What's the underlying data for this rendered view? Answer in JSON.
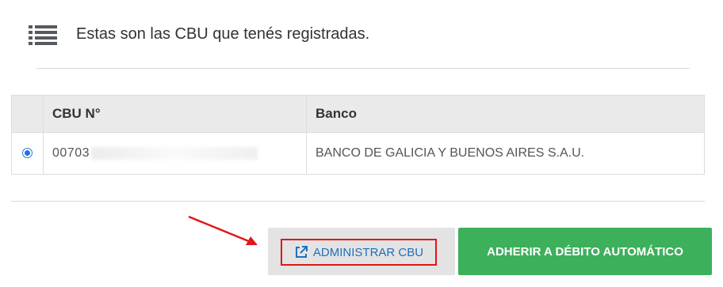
{
  "header": {
    "icon": "list-icon",
    "title": "Estas son las CBU que tenés registradas."
  },
  "table": {
    "columns": [
      "CBU N°",
      "Banco"
    ],
    "rows": [
      {
        "selected": true,
        "cbu_visible": "00703",
        "bank": "BANCO DE GALICIA Y BUENOS AIRES S.A.U."
      }
    ]
  },
  "actions": {
    "administrar_label": "ADMINISTRAR CBU",
    "administrar_icon": "external-link-icon",
    "adherir_label": "ADHERIR A DÉBITO AUTOMÁTICO"
  },
  "colors": {
    "primary_green": "#3cb05a",
    "link_blue": "#1f6fbf",
    "highlight_red": "#e0161a"
  }
}
